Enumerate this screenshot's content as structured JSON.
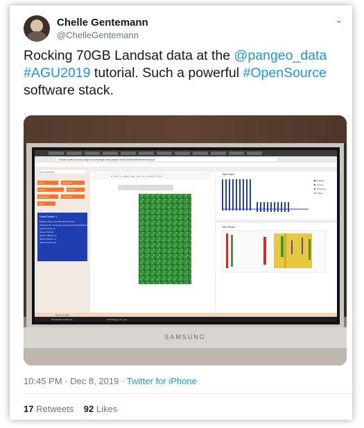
{
  "author": {
    "name": "Chelle Gentemann",
    "handle": "@ChelleGentemann"
  },
  "tweet": {
    "p1": "Rocking 70GB Landsat data at the ",
    "m1": "@pangeo_data",
    "h1": "#AGU2019",
    "p2": " tutorial.  Such a powerful ",
    "h2": "#OpenSource",
    "p3": " software stack."
  },
  "photo": {
    "laptop_brand": "SAMSUNG",
    "screen": {
      "url": "hub.aws-uswest2-binder.pangeo.io/user/pangeo-data-pangeo-tutorial-2pw6ld/lab/tree/landsat.ipynb",
      "left_buttons": [
        "Dask Dashboard",
        "Graph",
        "Task Stream",
        "Progress",
        "Workers",
        "Memory Use",
        "Cluster Map",
        "Profile"
      ],
      "cluster_title": "KubeCluster 1",
      "cluster_info": [
        "Scheduler Address: tcp://192.168.172.67:36193",
        "Dashboard URL: /user/pangeo-data-pangeo-tutorial-2pw6ld/proxy/8787/status",
        "Number of Cores: 20",
        "Memory: 75.00 GB",
        "Number of Workers: 10",
        "Minimum Workers: 10",
        "Maximum Workers: 10"
      ],
      "cell_code": "# Grab a subset and save as a netcdf file",
      "panel_task_graph": "Task Graph",
      "panel_task_stream": "Task Stream",
      "legend": [
        "released",
        "memory",
        "processing",
        "waiting"
      ],
      "status_text": "Python 3 | Idle",
      "taskbar_items": [
        "PeriodicWith 4 (00:11:2b",
        "AOS Package To...pptx"
      ]
    }
  },
  "meta": {
    "time": "10:45 PM",
    "sep": " · ",
    "date": "Dec 8, 2019",
    "source": "Twitter for iPhone"
  },
  "stats": {
    "retweets": "17",
    "retweets_label": "Retweets",
    "likes": "92",
    "likes_label": "Likes"
  },
  "colors": {
    "link": "#1b95e0",
    "muted": "#657786",
    "text": "#14171a",
    "jupyter_orange": "#f37626",
    "dask_blue": "#1f3fb0"
  }
}
